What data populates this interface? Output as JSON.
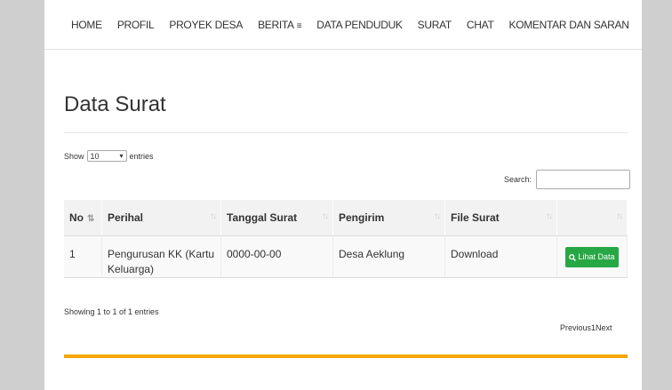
{
  "nav": {
    "items": [
      "HOME",
      "PROFIL",
      "PROYEK DESA",
      "BERITA",
      "DATA PENDUDUK",
      "SURAT",
      "CHAT",
      "KOMENTAR DAN SARAN"
    ],
    "berita_icon": "≡"
  },
  "page_title": "Data Surat",
  "length": {
    "show": "Show",
    "value": "10",
    "entries": "entries"
  },
  "search": {
    "label": "Search:",
    "value": ""
  },
  "table": {
    "columns": [
      "No",
      "Perihal",
      "Tanggal Surat",
      "Pengirim",
      "File Surat",
      ""
    ],
    "rows": [
      {
        "no": "1",
        "perihal": "Pengurusan KK (Kartu Keluarga)",
        "tanggal": "0000-00-00",
        "pengirim": "Desa Aeklung",
        "file": "Download",
        "action": "Lihat Data"
      }
    ]
  },
  "info": "Showing 1 to 1 of 1 entries",
  "pagination": {
    "previous": "Previous",
    "page": "1",
    "next": "Next"
  },
  "colors": {
    "accent": "#f5a700",
    "button": "#28a745",
    "background": "#cfcfcf"
  }
}
